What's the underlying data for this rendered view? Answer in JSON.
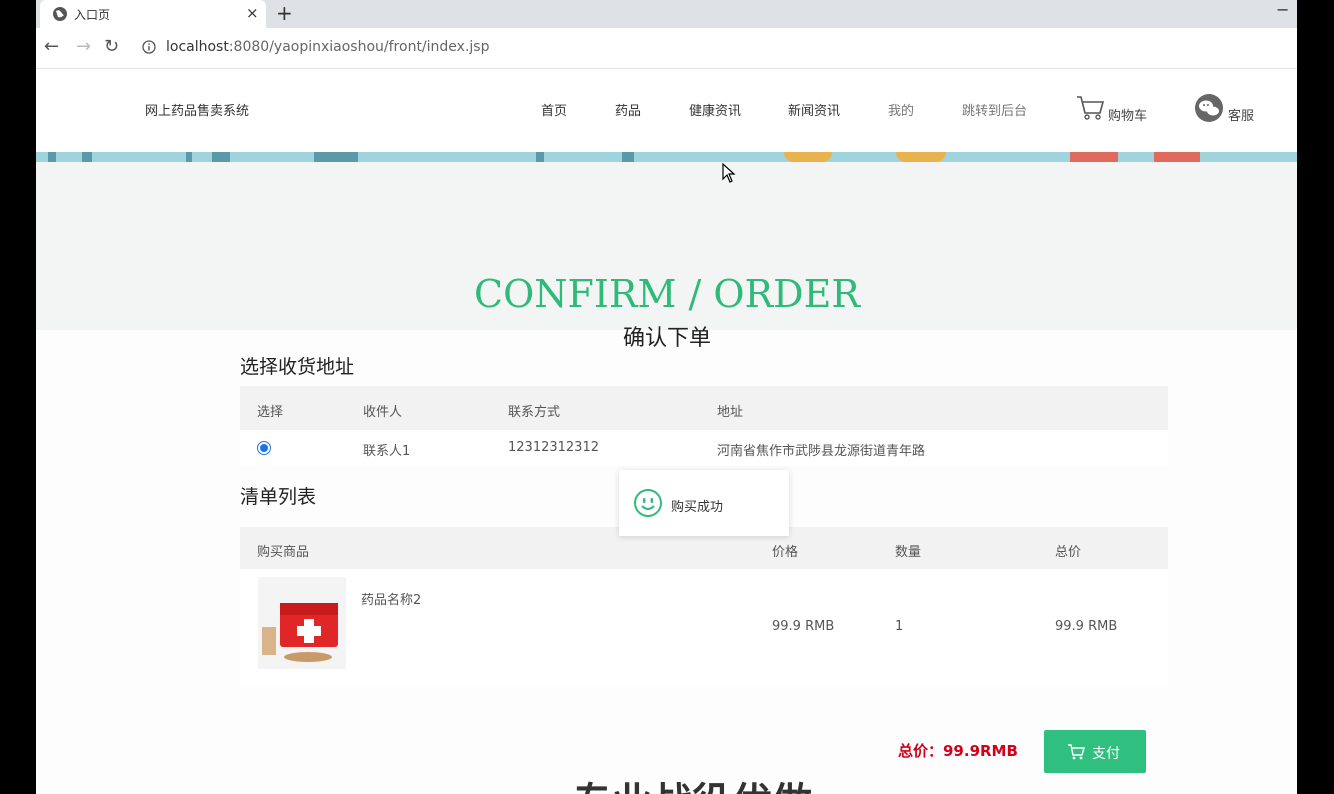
{
  "browser": {
    "tab_title": "入口页",
    "close_symbol": "×",
    "new_tab_symbol": "+",
    "minimize_symbol": "−",
    "back_symbol": "←",
    "forward_symbol": "→",
    "reload_symbol": "↻",
    "url_host": "localhost",
    "url_path": ":8080/yaopinxiaoshou/front/index.jsp"
  },
  "header": {
    "site_title": "网上药品售卖系统",
    "menu": [
      "首页",
      "药品",
      "健康资讯",
      "新闻资讯",
      "我的",
      "跳转到后台"
    ],
    "cart_label": "购物车",
    "service_label": "客服"
  },
  "main": {
    "title_en": "CONFIRM / ORDER",
    "title_cn": "确认下单",
    "address_section_title": "选择收货地址",
    "address_table": {
      "headers": [
        "选择",
        "收件人",
        "联系方式",
        "地址"
      ],
      "rows": [
        {
          "selected": true,
          "name": "联系人1",
          "phone": "12312312312",
          "address": "河南省焦作市武陟县龙源街道青年路"
        }
      ]
    },
    "list_section_title": "清单列表",
    "items_table": {
      "headers": [
        "购买商品",
        "价格",
        "数量",
        "总价"
      ],
      "rows": [
        {
          "name": "药品名称2",
          "price": "99.9 RMB",
          "quantity": "1",
          "subtotal": "99.9 RMB"
        }
      ]
    },
    "total_text": "总价：99.9RMB",
    "pay_label": "支付",
    "bottom_heading": "专业战役优做"
  },
  "toast": {
    "message": "购买成功"
  },
  "colors": {
    "accent_green": "#2fba7a",
    "total_red": "#d0021b",
    "pay_button": "#2fc07f"
  }
}
